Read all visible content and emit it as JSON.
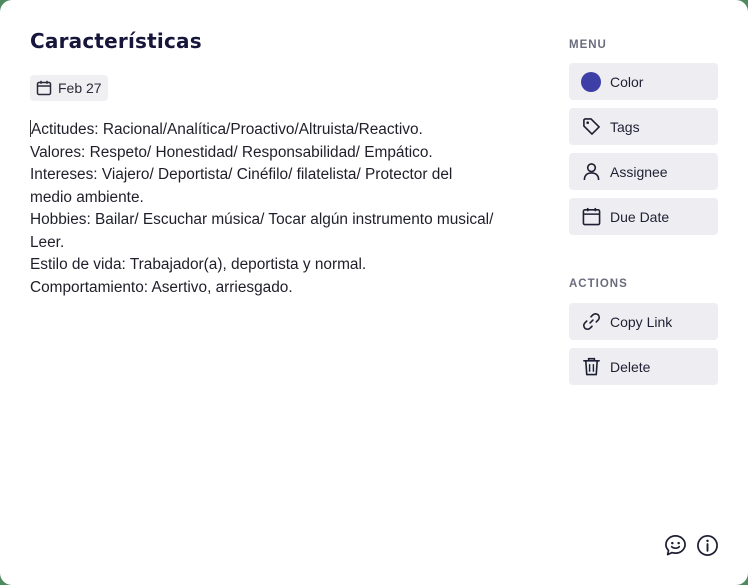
{
  "card": {
    "title": "Características",
    "date": "Feb 27",
    "body_lines": [
      "Actitudes: Racional/Analítica/Proactivo/Altruista/Reactivo.",
      "Valores: Respeto/ Honestidad/ Responsabilidad/ Empático.",
      "Intereses: Viajero/ Deportista/ Cinéfilo/ filatelista/ Protector del",
      "medio ambiente.",
      "Hobbies: Bailar/ Escuchar música/ Tocar algún instrumento musical/",
      "Leer.",
      "Estilo de vida: Trabajador(a), deportista y normal.",
      "Comportamiento: Asertivo, arriesgado."
    ]
  },
  "menu": {
    "label": "MENU",
    "items": [
      {
        "label": "Color",
        "icon": "color-swatch-icon",
        "color": "#3d3fa6"
      },
      {
        "label": "Tags",
        "icon": "tag-icon"
      },
      {
        "label": "Assignee",
        "icon": "user-icon"
      },
      {
        "label": "Due Date",
        "icon": "calendar-icon"
      }
    ]
  },
  "actions": {
    "label": "ACTIONS",
    "items": [
      {
        "label": "Copy Link",
        "icon": "link-icon"
      },
      {
        "label": "Delete",
        "icon": "trash-icon"
      }
    ]
  },
  "footer": {
    "icons": [
      "feedback-smile-icon",
      "info-icon"
    ]
  },
  "colors": {
    "background": "#4f8a5f",
    "card": "#ffffff",
    "button_bg": "#eeeef2",
    "title_text": "#16153a",
    "accent_color_dot": "#3d3fa6"
  }
}
